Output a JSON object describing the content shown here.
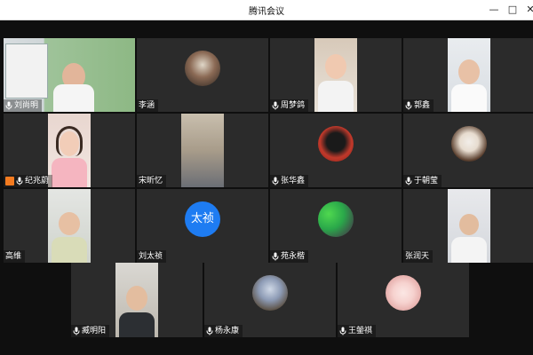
{
  "window": {
    "title": "腾讯会议",
    "controls": {
      "minimize": "—",
      "maximize": "□",
      "close": "✕"
    }
  },
  "participants": [
    {
      "name": "刘尚明",
      "kind": "video",
      "mic": true
    },
    {
      "name": "李涵",
      "kind": "avatar",
      "mic": false
    },
    {
      "name": "周梦鸽",
      "kind": "video",
      "mic": true
    },
    {
      "name": "郭鑫",
      "kind": "video",
      "mic": true
    },
    {
      "name": "纪兆蔚",
      "kind": "video",
      "mic": true,
      "screen_share_icon": true
    },
    {
      "name": "宋昕忆",
      "kind": "video",
      "mic": false
    },
    {
      "name": "张华鑫",
      "kind": "avatar",
      "mic": true
    },
    {
      "name": "于朝莹",
      "kind": "avatar",
      "mic": true
    },
    {
      "name": "高维",
      "kind": "video",
      "mic": false
    },
    {
      "name": "刘太祯",
      "kind": "text-avatar",
      "avatar_text": "太祯",
      "mic": false
    },
    {
      "name": "苑永楷",
      "kind": "avatar",
      "mic": true
    },
    {
      "name": "张润天",
      "kind": "video",
      "mic": false
    },
    {
      "name": "臧明阳",
      "kind": "video",
      "mic": true
    },
    {
      "name": "杨永康",
      "kind": "avatar",
      "mic": true
    },
    {
      "name": "王鎣祺",
      "kind": "avatar",
      "mic": true
    }
  ],
  "colors": {
    "tile_bg": "#2b2b2b",
    "text_avatar_bg": "#1e7cf2",
    "screen_share_badge": "#f47b20"
  }
}
